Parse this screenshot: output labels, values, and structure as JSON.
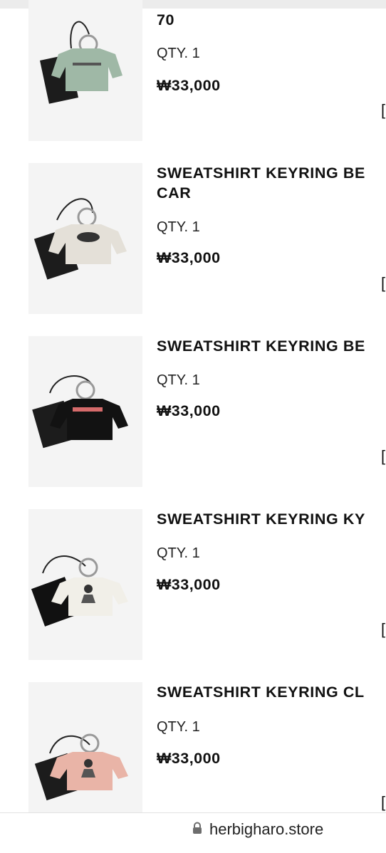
{
  "cart": {
    "items": [
      {
        "title": "70",
        "qty": "QTY. 1",
        "price": "₩33,000",
        "sweater_color": "#9fb8a6",
        "tag_color": "#1c1c1c",
        "print": "text"
      },
      {
        "title": "SWEATSHIRT KEYRING BE\nCAR",
        "qty": "QTY. 1",
        "price": "₩33,000",
        "sweater_color": "#e4e0d8",
        "tag_color": "#1c1c1c",
        "print": "car"
      },
      {
        "title": "SWEATSHIRT KEYRING BE",
        "qty": "QTY. 1",
        "price": "₩33,000",
        "sweater_color": "#121212",
        "tag_color": "#1c1c1c",
        "print": "logo"
      },
      {
        "title": "SWEATSHIRT KEYRING KY",
        "qty": "QTY. 1",
        "price": "₩33,000",
        "sweater_color": "#f1efe8",
        "tag_color": "#111111",
        "print": "figure"
      },
      {
        "title": "SWEATSHIRT KEYRING CL",
        "qty": "QTY. 1",
        "price": "₩33,000",
        "sweater_color": "#e9b4a7",
        "tag_color": "#1c1c1c",
        "print": "figure"
      }
    ],
    "bracket_glyph": "["
  },
  "browser": {
    "url": "herbigharo.store",
    "lock_icon": "lock-icon"
  }
}
